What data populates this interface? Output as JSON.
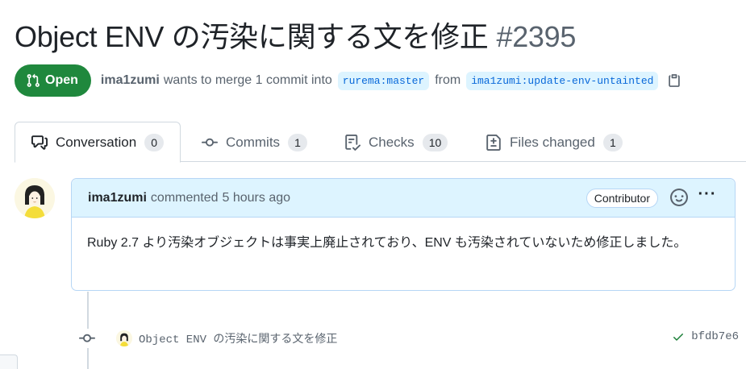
{
  "pr": {
    "title": "Object ENV の汚染に関する文を修正",
    "number": "#2395",
    "state_label": "Open",
    "author": "ima1zumi",
    "action_text": "wants to merge 1 commit into",
    "base_branch": "rurema:master",
    "from_text": "from",
    "head_branch": "ima1zumi:update-env-untainted"
  },
  "tabs": [
    {
      "label": "Conversation",
      "count": "0"
    },
    {
      "label": "Commits",
      "count": "1"
    },
    {
      "label": "Checks",
      "count": "10"
    },
    {
      "label": "Files changed",
      "count": "1"
    }
  ],
  "comment": {
    "author": "ima1zumi",
    "action": "commented",
    "time": "5 hours ago",
    "badge": "Contributor",
    "more": "···",
    "body": "Ruby 2.7 より汚染オブジェクトは事実上廃止されており、ENV も汚染されていないため修正しました。"
  },
  "commit": {
    "message": "Object ENV の汚染に関する文を修正",
    "sha": "bfdb7e6"
  },
  "colors": {
    "open_green": "#1f883d",
    "link_blue": "#0969da",
    "header_blue": "#ddf4ff",
    "check_green": "#1a7f37"
  }
}
